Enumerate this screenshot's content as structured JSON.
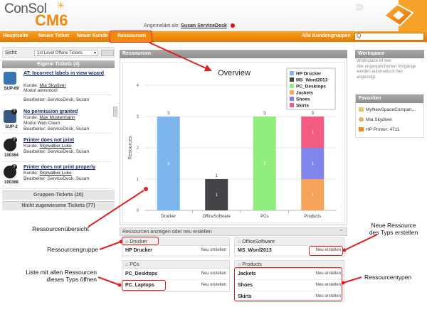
{
  "app": {
    "logo_consol": "ConSol",
    "logo_cm6": "CM6",
    "login_prefix": "Angemeldet als:",
    "login_user": "Susan ServiceDesk"
  },
  "nav": {
    "items": [
      "Hauptseite",
      "Neues Ticket",
      "Neuer Kunde",
      "Ressourcen"
    ],
    "right": "Alle Kundengruppen",
    "search_placeholder": "Q"
  },
  "left": {
    "view_label": "Sicht:",
    "view_value": "1st Level Offene Tickets",
    "own_tickets": "Eigene Tickets (4)",
    "tickets": [
      {
        "num": "SUP-69",
        "title": "AT: Incorrect labels in view wizard",
        "kunde_prefix": "Kunde:",
        "kunde": "Mia Skydiver",
        "modul_prefix": "Modul",
        "modul": "admintool",
        "bearb_prefix": "Bearbeiter:",
        "bearb": "ServiceDesk, Susan"
      },
      {
        "num": "SUP-2",
        "title": "No permission granted",
        "kunde_prefix": "Kunde:",
        "kunde": "Max Mustermann",
        "modul_prefix": "Modul",
        "modul": "Web.Client",
        "bearb_prefix": "Bearbeiter:",
        "bearb": "ServiceDesk, Susan"
      },
      {
        "num": "100364",
        "title": "Printer does not print",
        "kunde_prefix": "Kunde:",
        "kunde": "Skywalker,Luke",
        "bearb_prefix": "Bearbeiter:",
        "bearb": "ServiceDesk, Susan"
      },
      {
        "num": "100368",
        "title": "Printer does not print properly",
        "kunde_prefix": "Kunde:",
        "kunde": "Skywalker,Luke",
        "bearb_prefix": "Bearbeiter:",
        "bearb": "ServiceDesk, Susan"
      }
    ],
    "group_tickets": "Gruppen-Tickets (20)",
    "unassigned_tickets": "Nicht zugewiesene Tickets (77)"
  },
  "main": {
    "title": "Ressourcen",
    "sub_title": "Ressourcen anzeigen oder neu erstellen",
    "groups": [
      {
        "name": "Drucker",
        "rows": [
          {
            "name": "HP Drucker",
            "action": "Neu erstellen"
          }
        ]
      },
      {
        "name": "OfficeSoftware",
        "rows": [
          {
            "name": "MS_Word2013",
            "action": "Neu erstellen"
          }
        ]
      },
      {
        "name": "PCs",
        "rows": [
          {
            "name": "PC_Desktops",
            "action": "Neu erstellen"
          },
          {
            "name": "PC_Laptops",
            "action": "Neu erstellen"
          }
        ]
      },
      {
        "name": "Products",
        "rows": [
          {
            "name": "Jackets",
            "action": "Neu erstellen"
          },
          {
            "name": "Shoes",
            "action": "Neu erstellen"
          },
          {
            "name": "Skirts",
            "action": "Neu erstellen"
          }
        ]
      }
    ]
  },
  "right": {
    "workspace_title": "Workspace",
    "workspace_text": "Workspace ist leer\nAlle ungespeicherten Vorgänge werden automatisch hier angezeigt.",
    "favorites_title": "Favoriten",
    "favorites": [
      "MyNewSpaceCompan...",
      "Mia Skydiver",
      "HP Printer: 4711"
    ]
  },
  "annotations": {
    "overview": "Ressourcenübersicht",
    "group": "Ressourcengruppe",
    "list_line1": "Liste mit allen Ressourcen",
    "list_line2": "dieses Typs öffnen",
    "new_line1": "Neue Ressource",
    "new_line2": "des Typs erstellen",
    "types": "Ressourcentypen"
  },
  "chart_data": {
    "type": "bar",
    "title": "Overview",
    "ylabel": "Resources",
    "categories": [
      "Drucker",
      "OfficeSoftware",
      "PCs",
      "Products"
    ],
    "ylim": [
      0,
      4
    ],
    "yticks": [
      0,
      1,
      2,
      3,
      4
    ],
    "series": [
      {
        "name": "HP Drucker",
        "color": "#7cb5ec",
        "values": [
          3,
          0,
          0,
          0
        ]
      },
      {
        "name": "MS_Word2013",
        "color": "#434348",
        "values": [
          0,
          1,
          0,
          0
        ]
      },
      {
        "name": "PC_Desktops",
        "color": "#90ed7d",
        "values": [
          0,
          0,
          3,
          0
        ]
      },
      {
        "name": "Jackets",
        "color": "#f7a35c",
        "values": [
          0,
          0,
          0,
          1
        ]
      },
      {
        "name": "Shoes",
        "color": "#8085e9",
        "values": [
          0,
          0,
          0,
          1
        ]
      },
      {
        "name": "Skirts",
        "color": "#f15c80",
        "values": [
          0,
          0,
          0,
          1
        ]
      }
    ],
    "totals": [
      3,
      1,
      3,
      3
    ],
    "legend_position": "top-right"
  }
}
